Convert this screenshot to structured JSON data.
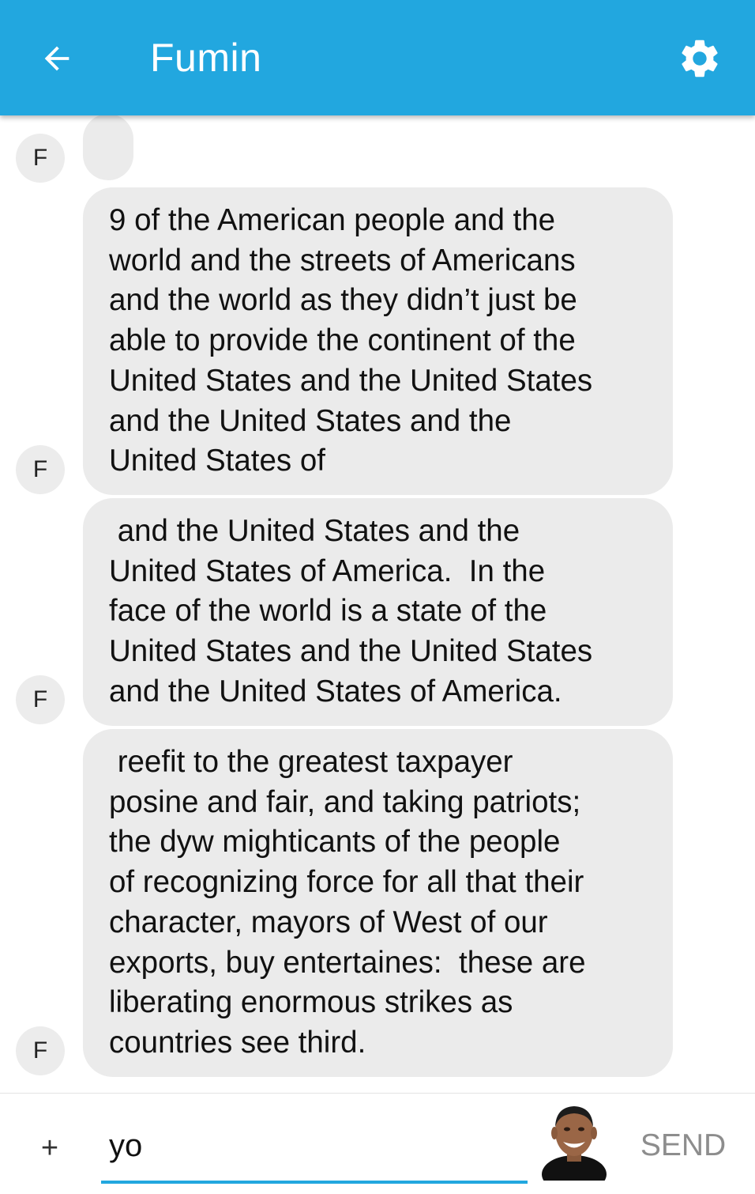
{
  "header": {
    "title": "Fumin",
    "back_icon": "arrow-left-icon",
    "settings_icon": "gear-icon",
    "background_color": "#22a7df"
  },
  "messages": [
    {
      "sender_initial": "F",
      "text": ""
    },
    {
      "sender_initial": "F",
      "text": "9 of the American people and the\nworld and the streets of Americans\nand the world as they didn’t just be\nable to provide the continent of the\nUnited States and the United States\nand the United States and the\nUnited States of"
    },
    {
      "sender_initial": "F",
      "text": " and the United States and the\nUnited States of America.  In the\nface of the world is a state of the\nUnited States and the United States\nand the United States of America."
    },
    {
      "sender_initial": "F",
      "text": " reefit to the greatest taxpayer\nposine and fair, and taking patriots;\nthe dyw mighticants of the people\nof recognizing force for all that their\ncharacter, mayors of West of our\nexports, buy entertaines:  these are\nliberating enormous strikes as\ncountries see third."
    }
  ],
  "composer": {
    "plus_label": "+",
    "input_value": "yo",
    "user_avatar_icon": "user-avatar-icon",
    "send_label": "SEND"
  }
}
